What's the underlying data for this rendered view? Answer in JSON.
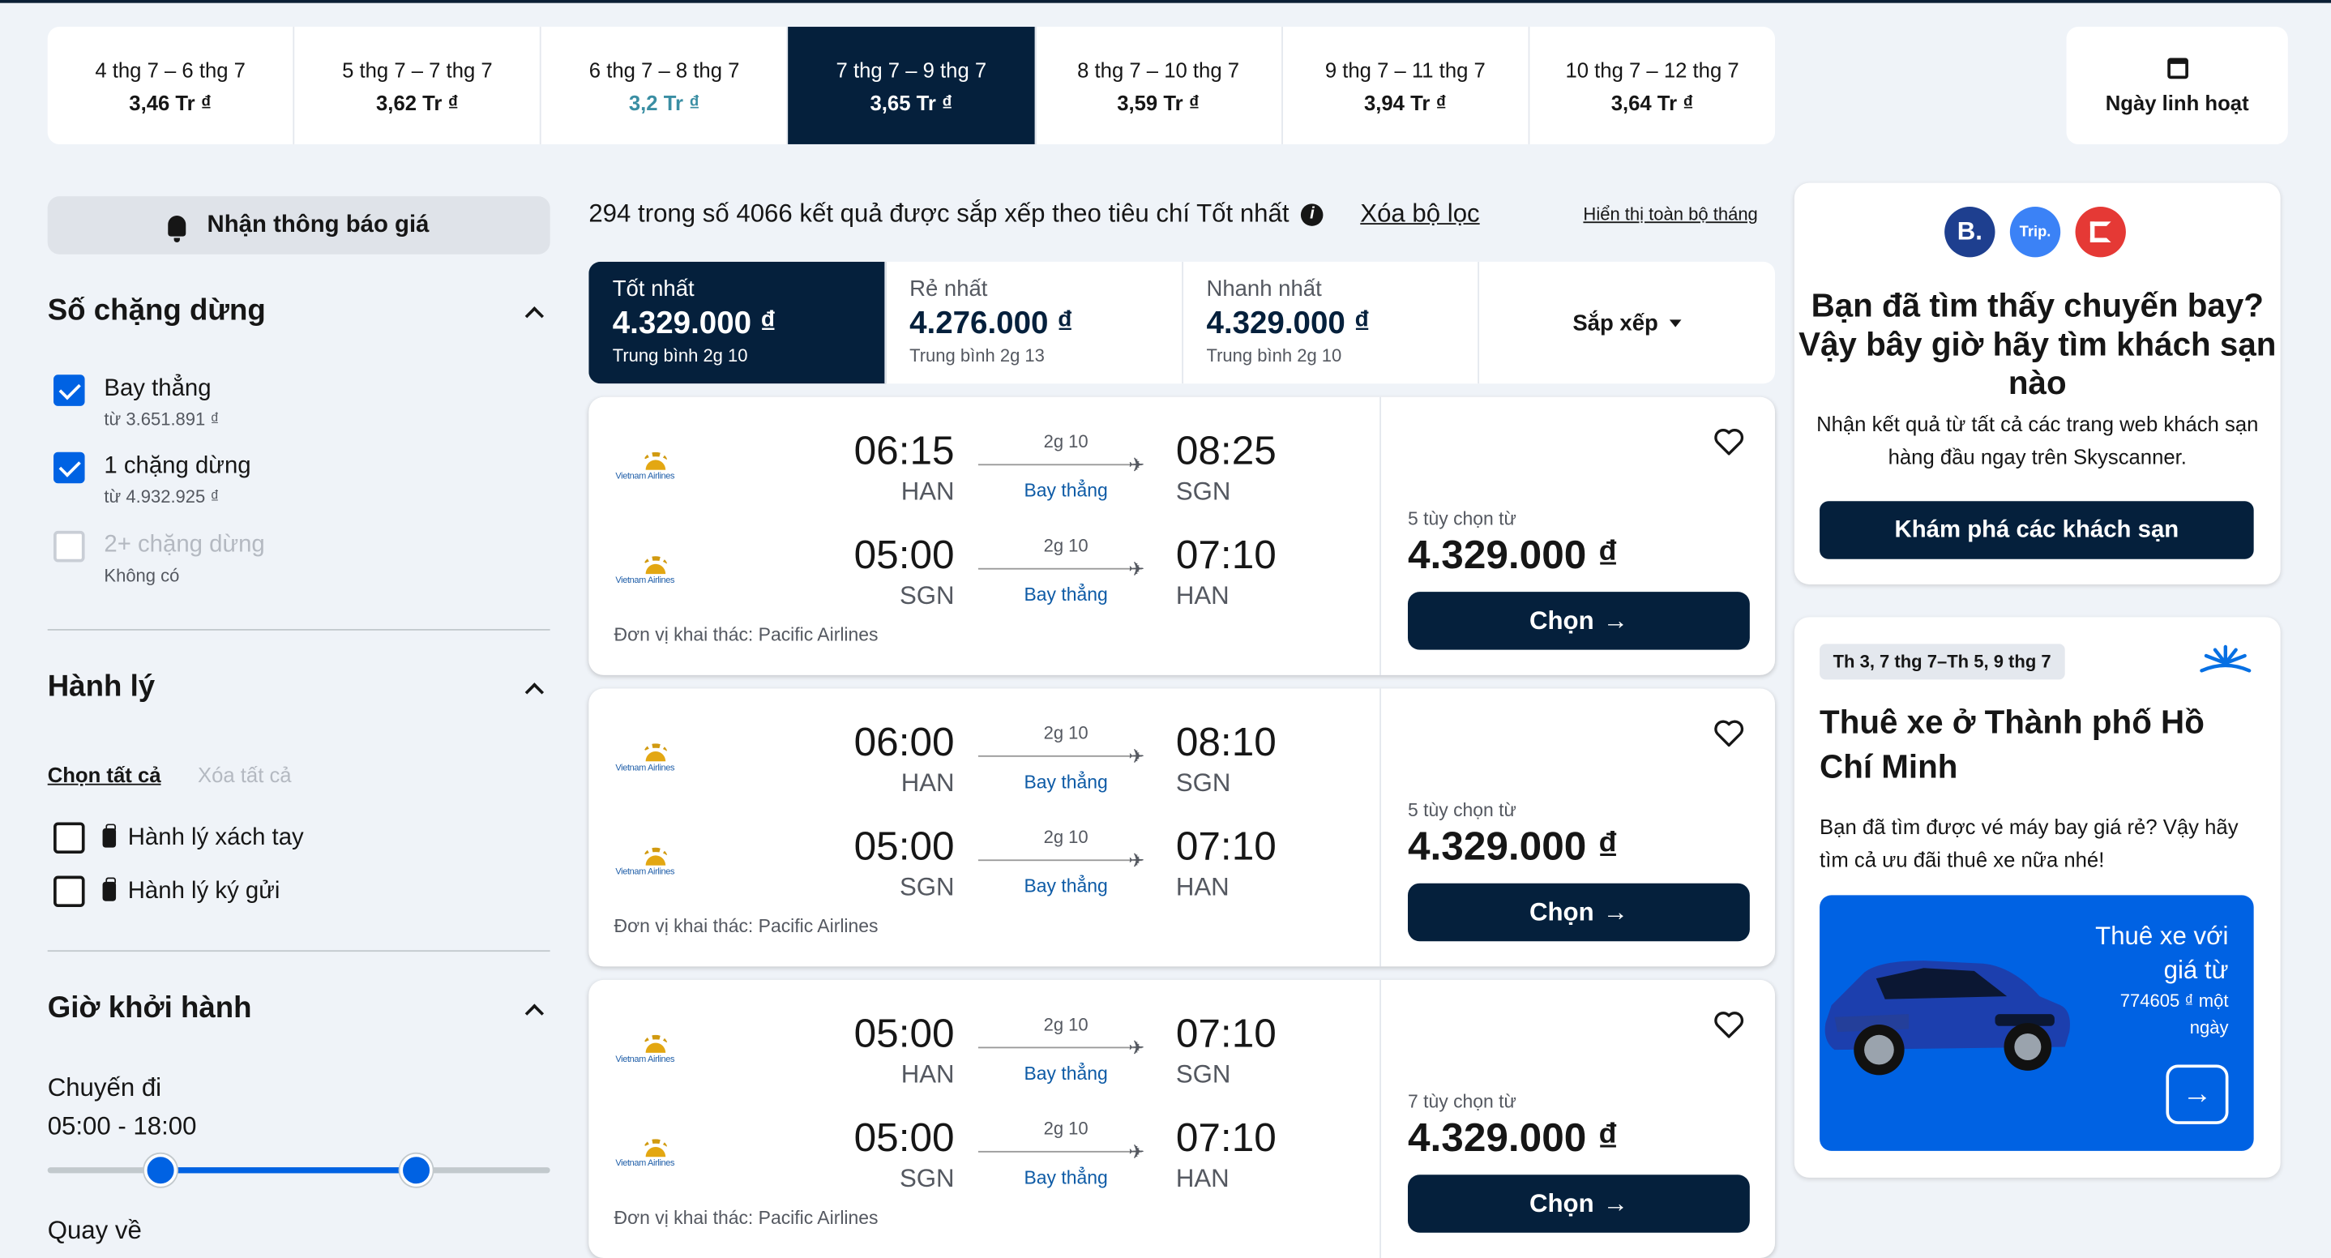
{
  "date_strip": [
    {
      "label": "4 thg 7 – 6 thg 7",
      "price": "3,46 Tr ₫"
    },
    {
      "label": "5 thg 7 – 7 thg 7",
      "price": "3,62 Tr ₫"
    },
    {
      "label": "6 thg 7 – 8 thg 7",
      "price": "3,2 Tr ₫"
    },
    {
      "label": "7 thg 7 – 9 thg 7",
      "price": "3,65 Tr ₫"
    },
    {
      "label": "8 thg 7 – 10 thg 7",
      "price": "3,59 Tr ₫"
    },
    {
      "label": "9 thg 7 – 11 thg 7",
      "price": "3,94 Tr ₫"
    },
    {
      "label": "10 thg 7 – 12 thg 7",
      "price": "3,64 Tr ₫"
    }
  ],
  "selected_date_index": 3,
  "cheapest_date_index": 2,
  "flexible_dates_label": "Ngày linh hoạt",
  "sidebar": {
    "price_alert_label": "Nhận thông báo giá",
    "stops": {
      "title": "Số chặng dừng",
      "options": [
        {
          "label": "Bay thẳng",
          "sub": "từ 3.651.891 ₫",
          "checked": true
        },
        {
          "label": "1 chặng dừng",
          "sub": "từ 4.932.925 ₫",
          "checked": true
        },
        {
          "label": "2+ chặng dừng",
          "sub": "Không có",
          "checked": false,
          "disabled": true
        }
      ]
    },
    "baggage": {
      "title": "Hành lý",
      "select_all": "Chọn tất cả",
      "clear_all": "Xóa tất cả",
      "options": [
        {
          "label": "Hành lý xách tay",
          "checked": false
        },
        {
          "label": "Hành lý ký gửi",
          "checked": false
        }
      ]
    },
    "departure_time": {
      "title": "Giờ khởi hành",
      "outbound_label": "Chuyến đi",
      "outbound_range": "05:00 - 18:00",
      "return_label": "Quay về"
    }
  },
  "results": {
    "summary": "294 trong số 4066 kết quả được sắp xếp theo tiêu chí Tốt nhất",
    "clear_filters": "Xóa bộ lọc",
    "show_month": "Hiển thị toàn bộ tháng",
    "sort_tabs": [
      {
        "name": "Tốt nhất",
        "price": "4.329.000 ₫",
        "duration": "Trung bình 2g 10",
        "active": true
      },
      {
        "name": "Rẻ nhất",
        "price": "4.276.000 ₫",
        "duration": "Trung bình 2g 13",
        "active": false
      },
      {
        "name": "Nhanh nhất",
        "price": "4.329.000 ₫",
        "duration": "Trung bình 2g 10",
        "active": false
      }
    ],
    "sort_label": "Sắp xếp",
    "airline_name": "Vietnam Airlines",
    "flights": [
      {
        "legs": [
          {
            "dep": "06:15",
            "from": "HAN",
            "dur": "2g 10",
            "stops": "Bay thẳng",
            "arr": "08:25",
            "to": "SGN"
          },
          {
            "dep": "05:00",
            "from": "SGN",
            "dur": "2g 10",
            "stops": "Bay thẳng",
            "arr": "07:10",
            "to": "HAN"
          }
        ],
        "operator": "Đơn vị khai thác: Pacific Airlines",
        "options": "5 tùy chọn từ",
        "price": "4.329.000 ₫",
        "cta": "Chọn"
      },
      {
        "legs": [
          {
            "dep": "06:00",
            "from": "HAN",
            "dur": "2g 10",
            "stops": "Bay thẳng",
            "arr": "08:10",
            "to": "SGN"
          },
          {
            "dep": "05:00",
            "from": "SGN",
            "dur": "2g 10",
            "stops": "Bay thẳng",
            "arr": "07:10",
            "to": "HAN"
          }
        ],
        "operator": "Đơn vị khai thác: Pacific Airlines",
        "options": "5 tùy chọn từ",
        "price": "4.329.000 ₫",
        "cta": "Chọn"
      },
      {
        "legs": [
          {
            "dep": "05:00",
            "from": "HAN",
            "dur": "2g 10",
            "stops": "Bay thẳng",
            "arr": "07:10",
            "to": "SGN"
          },
          {
            "dep": "05:00",
            "from": "SGN",
            "dur": "2g 10",
            "stops": "Bay thẳng",
            "arr": "07:10",
            "to": "HAN"
          }
        ],
        "operator": "Đơn vị khai thác: Pacific Airlines",
        "options": "7 tùy chọn từ",
        "price": "4.329.000 ₫",
        "cta": "Chọn"
      }
    ]
  },
  "hotel_ad": {
    "partners": [
      {
        "name": "B.",
        "color": "#1e3f8f"
      },
      {
        "name": "Trip.",
        "color": "#3b82f6"
      },
      {
        "name": "A",
        "color": "#e53935"
      }
    ],
    "title": "Bạn đã tìm thấy chuyến bay? Vậy bây giờ hãy tìm khách sạn nào",
    "subtitle": "Nhận kết quả từ tất cả các trang web khách sạn hàng đầu ngay trên Skyscanner.",
    "button": "Khám phá các khách sạn"
  },
  "car_ad": {
    "date_tag": "Th 3, 7 thg 7–Th 5, 9 thg 7",
    "title": "Thuê xe ở Thành phố Hồ Chí Minh",
    "subtitle": "Bạn đã tìm được vé máy bay giá rẻ? Vậy hãy tìm cả ưu đãi thuê xe nữa nhé!",
    "promo_title": "Thuê xe với giá từ",
    "promo_price": "774605 ₫ một ngày"
  },
  "colors": {
    "brand_dark": "#05203c",
    "accent_blue": "#0062e3",
    "cheap_teal": "#3a8ea3",
    "page_bg": "#eff3f8"
  }
}
